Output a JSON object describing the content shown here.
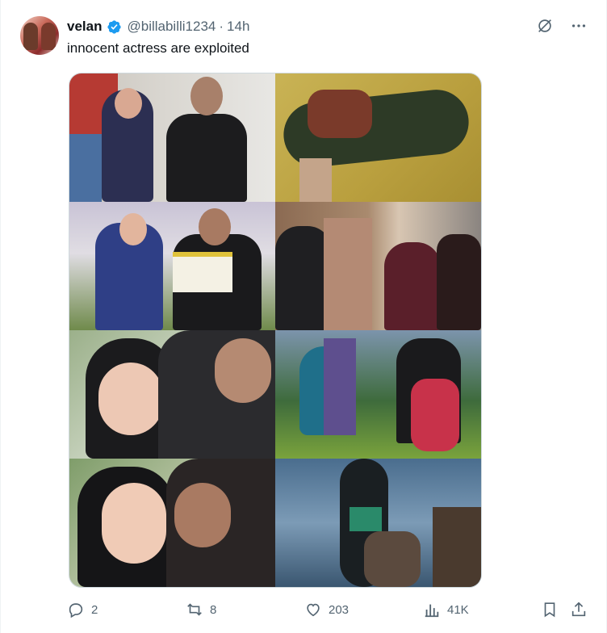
{
  "post": {
    "author_name": "velan",
    "handle": "@billabilli1234",
    "separator": "·",
    "time": "14h",
    "text": "innocent actress are exploited"
  },
  "actions": {
    "replies": "2",
    "reposts": "8",
    "likes": "203",
    "views": "41K"
  },
  "icons": {
    "verified": "verified-badge-icon",
    "grok": "grok-icon",
    "more": "more-icon",
    "reply": "reply-icon",
    "repost": "repost-icon",
    "like": "heart-icon",
    "views": "views-icon",
    "bookmark": "bookmark-icon",
    "share": "share-icon"
  },
  "colors": {
    "text_primary": "#0f1419",
    "text_secondary": "#536471",
    "verified_blue": "#1d9bf0"
  }
}
